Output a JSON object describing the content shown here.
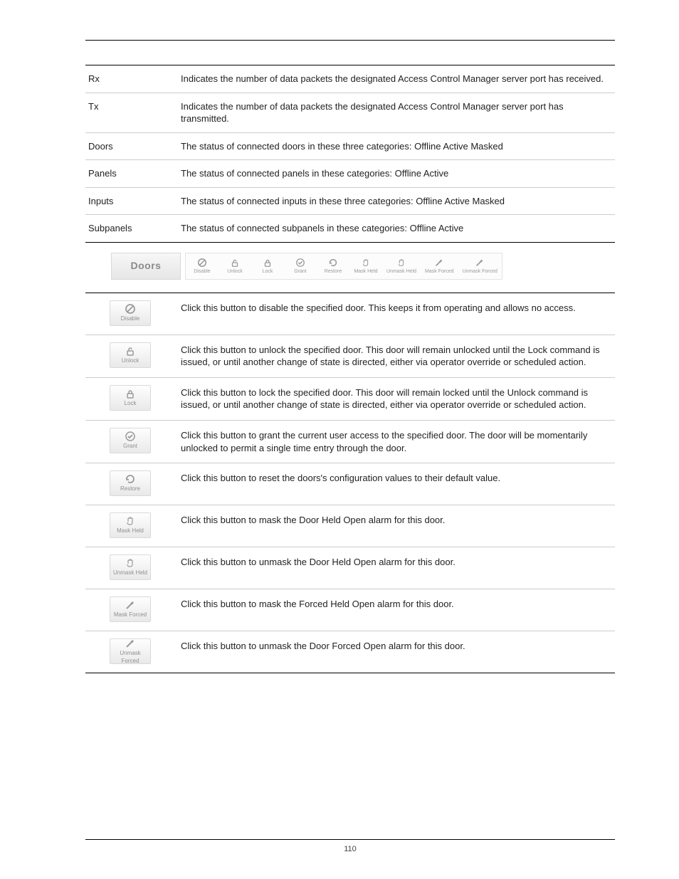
{
  "page_number": "110",
  "table1": {
    "rows": [
      {
        "term": "Rx",
        "desc": "Indicates the number of data packets the designated Access Control Manager server port has received."
      },
      {
        "term": "Tx",
        "desc": "Indicates the number of data packets the designated Access Control Manager server port has transmitted."
      },
      {
        "term": "Doors",
        "desc": "The status of connected doors in these three categories: Offline Active Masked"
      },
      {
        "term": "Panels",
        "desc": "The status of connected panels in these categories: Offline Active"
      },
      {
        "term": "Inputs",
        "desc": "The status of connected inputs in these three categories: Offline Active Masked"
      },
      {
        "term": "Subpanels",
        "desc": "The status of connected subpanels in these categories: Offline Active"
      }
    ]
  },
  "toolbar": {
    "title": "Doors",
    "buttons": [
      {
        "label": "Disable"
      },
      {
        "label": "Unlock"
      },
      {
        "label": "Lock"
      },
      {
        "label": "Grant"
      },
      {
        "label": "Restore"
      },
      {
        "label": "Mask Held"
      },
      {
        "label": "Unmask Held"
      },
      {
        "label": "Mask Forced"
      },
      {
        "label": "Unmask Forced"
      }
    ]
  },
  "table2": {
    "rows": [
      {
        "label": "Disable",
        "desc": "Click this button to disable the specified door. This keeps it from operating and allows no access."
      },
      {
        "label": "Unlock",
        "desc": "Click this button to unlock the specified door. This door will remain unlocked until the Lock command is issued, or until another change of state is directed, either via operator override or scheduled action."
      },
      {
        "label": "Lock",
        "desc": "Click this button to lock the specified door. This door will remain locked until the Unlock command is issued, or until another change of state is directed, either via operator override or scheduled action."
      },
      {
        "label": "Grant",
        "desc": "Click this button to grant the current user access to the specified door. The door will be momentarily unlocked to permit a single time entry through the door."
      },
      {
        "label": "Restore",
        "desc": "Click this button to reset the doors's configuration values to their default value."
      },
      {
        "label": "Mask Held",
        "desc": "Click this button to mask the Door Held Open alarm for this door."
      },
      {
        "label": "Unmask Held",
        "desc": "Click this button to unmask the Door Held Open alarm for this door."
      },
      {
        "label": "Mask Forced",
        "desc": "Click this button to mask the Forced Held Open alarm for this door."
      },
      {
        "label": "Unmask Forced",
        "desc": "Click this button to unmask the Door Forced Open alarm for this door."
      }
    ]
  }
}
